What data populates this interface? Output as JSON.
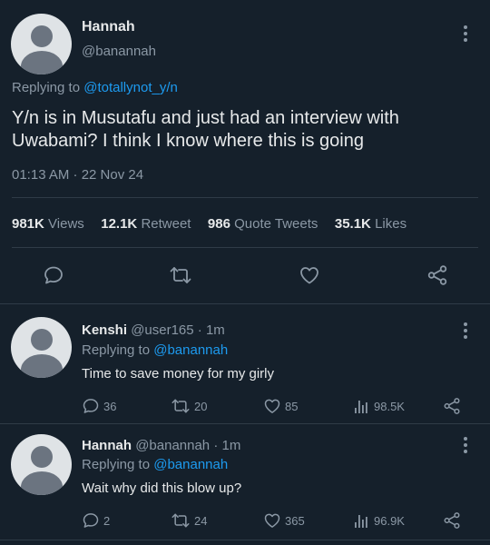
{
  "main_tweet": {
    "author_name": "Hannah",
    "handle": "@banannah",
    "replying_prefix": "Replying to ",
    "replying_to": "@totallynot_y/n",
    "text_line1": "Y/n is in Musutafu and just had an interview with",
    "text_line2": "Uwabami? I think I know where this is going",
    "timestamp": "01:13 AM · 22 Nov 24",
    "stats": {
      "views_count": "981K",
      "views_label": "Views",
      "retweets_count": "12.1K",
      "retweets_label": "Retweet",
      "quotes_count": "986",
      "quotes_label": "Quote Tweets",
      "likes_count": "35.1K",
      "likes_label": "Likes"
    }
  },
  "replies": [
    {
      "author_name": "Kenshi",
      "handle_time": "@user165 · 1m",
      "replying_prefix": "Replying to ",
      "replying_to": "@banannah",
      "text": "Time to save money for my girly",
      "replies": "36",
      "retweets": "20",
      "likes": "85",
      "views": "98.5K"
    },
    {
      "author_name": "Hannah",
      "handle_time": "@banannah · 1m",
      "replying_prefix": "Replying to ",
      "replying_to": "@banannah",
      "text": "Wait why did this blow up?",
      "replies": "2",
      "retweets": "24",
      "likes": "365",
      "views": "96.9K"
    }
  ],
  "colors": {
    "background": "#15202b",
    "link": "#1d9bf0",
    "muted": "#8b98a5",
    "divider": "#2f3b47"
  },
  "icons": [
    "kebab-menu-icon",
    "reply-icon",
    "retweet-icon",
    "like-icon",
    "share-icon",
    "views-icon"
  ]
}
